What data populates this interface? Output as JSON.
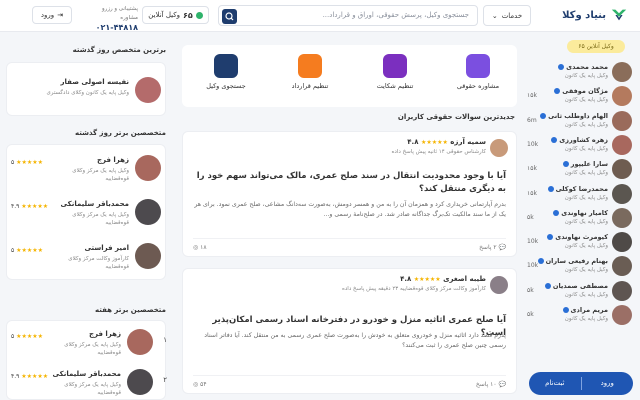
{
  "header": {
    "logo_text": "بنیاد وکلا",
    "services_label": "خدمات",
    "search_placeholder": "جستجوی وکیل، پرسش حقوقی، اوراق و قرارداد...",
    "online_count": "۶۵",
    "online_label": "وکیل آنلاین",
    "support_label": "پشتیبانی و رزرو مشاوره",
    "support_phone": "۰۲۱-۴۴۸۱۸",
    "login_label": "ورود"
  },
  "right_column": {
    "online_pill": "۶۵ وکیل آنلاین",
    "lawyers": [
      {
        "name": "محمد محمدی",
        "sub": "وکیل پایه یک کانون",
        "count": ""
      },
      {
        "name": "مژگان موفقی",
        "sub": "وکیل پایه یک کانون",
        "count": "۱۵k"
      },
      {
        "name": "الهام داوطلب ثانی",
        "sub": "وکیل پایه یک کانون",
        "count": "6m"
      },
      {
        "name": "زهره کشاورزی",
        "sub": "وکیل پایه یک کانون",
        "count": "10k"
      },
      {
        "name": "سارا علیپور",
        "sub": "وکیل پایه یک کانون",
        "count": "۱۵k"
      },
      {
        "name": "محمدرضا کوکلی",
        "sub": "وکیل پایه یک کانون",
        "count": "۱۵k"
      },
      {
        "name": "کامیار نهاوندی",
        "sub": "وکیل پایه یک کانون",
        "count": "۵k"
      },
      {
        "name": "کیومرث نهاوندی",
        "sub": "وکیل پایه یک کانون",
        "count": "10k"
      },
      {
        "name": "بهنام رفیعی ساران",
        "sub": "وکیل پایه یک کانون",
        "count": "10k"
      },
      {
        "name": "مصطفی صمدیان",
        "sub": "وکیل پایه یک کانون",
        "count": "۵k"
      },
      {
        "name": "مریم مرادی",
        "sub": "وکیل پایه یک کانون",
        "count": "۵k"
      }
    ],
    "cta_login": "ورود",
    "cta_register": "ثبت‌نام"
  },
  "actions": [
    {
      "label": "مشاوره حقوقی",
      "color": "#7b4fe0"
    },
    {
      "label": "تنظیم شکایت",
      "color": "#7b2fbf"
    },
    {
      "label": "تنظیم قرارداد",
      "color": "#f57c1f"
    },
    {
      "label": "جستجوی وکیل",
      "color": "#1f3d6e"
    }
  ],
  "questions_title": "جدیدترین سوالات حقوقی کاربران",
  "questions": [
    {
      "name": "سمیه آرزه",
      "rating": "۴.۸",
      "sub": "کارشناس حقوقی ۱۴ ثانیه پیش پاسخ داده",
      "title": "آیا با وجود محدودیت انتقال در سند صلح عمری، مالک می‌تواند سهم خود را به دیگری منتقل کند؟",
      "body": "بدرم آپارتمانی خریداری کرد و همزمان آن را به من و همسر دومش، به‌صورت سه‌دانگ مشاعی، صلح عمری نمود. برای هر یک از ما سند مالکیت تک‌برگ جداگانه صادر شد. در صلح‌نامهٔ رسمی و...",
      "answers": "۲ پاسخ",
      "views": "۱۸"
    },
    {
      "name": "طیبه اصغری",
      "rating": "۴.۸",
      "sub": "کارآموز وکالت مرکز وکلای قوه‌قضاییه ۲۳ دقیقه پیش پاسخ داده",
      "title": "آیا صلح عمری اثاثیه منزل و خودرو در دفترخانه اسناد رسمی امکان‌پذیر است؟",
      "body": "پدرم قصد دارد اثاثیه منزل و خودروی متعلق به خودش را به‌صورت صلح عمری رسمی به من منتقل کند. آیا دفاتر اسناد رسمی چنین صلح عمری را ثبت می‌کنند؟",
      "answers": "۱۰ پاسخ",
      "views": "۵۴"
    }
  ],
  "left_column": {
    "top_day_title": "برترین متخصص روز گذشته",
    "top_day": {
      "name": "نفیسه اصولی صفار",
      "sub": "وکیل پایه یک کانون وکلای دادگستری"
    },
    "top_week_title": "متخصصین برتر روز گذشته",
    "top_week": [
      {
        "name": "زهرا فرج",
        "sub": "وکیل پایه یک مرکز وکلای قوه‌قضاییه",
        "rating": "۵"
      },
      {
        "name": "محمدباقر سلیمانکی",
        "sub": "وکیل پایه یک مرکز وکلای قوه‌قضاییه",
        "rating": "۴.۹"
      },
      {
        "name": "امیر فراستی",
        "sub": "کارآموز وکالت مرکز وکلای قوه‌قضاییه",
        "rating": "۵"
      }
    ],
    "top_month_title": "متخصصین برتر هفته",
    "top_month": [
      {
        "rank": "۱",
        "name": "زهرا فرج",
        "sub": "وکیل پایه یک مرکز وکلای قوه‌قضاییه",
        "rating": "۵"
      },
      {
        "rank": "۲",
        "name": "محمدباقر سلیمانکی",
        "sub": "وکیل پایه یک مرکز وکلای قوه‌قضاییه",
        "rating": "۴.۹"
      }
    ],
    "stars": "★★★★★"
  }
}
